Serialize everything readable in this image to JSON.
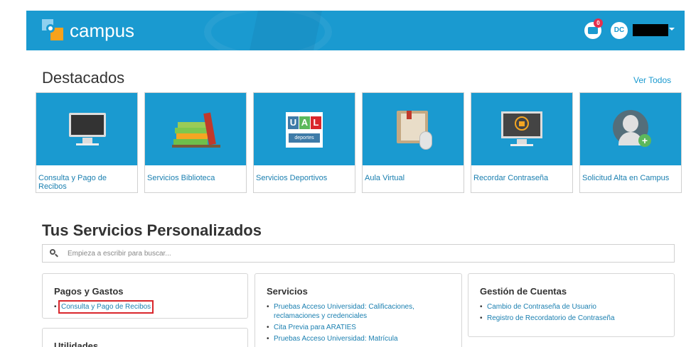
{
  "topbar": {
    "brand": "campus",
    "mail_badge": "0",
    "avatar_initials": "DC",
    "color": "#1a9ad0"
  },
  "destacados": {
    "title": "Destacados",
    "ver_todos": "Ver Todos",
    "cards": [
      {
        "label": "Consulta y Pago de Recibos",
        "icon": "monitor-icon"
      },
      {
        "label": "Servicios Biblioteca",
        "icon": "books-icon"
      },
      {
        "label": "Servicios Deportivos",
        "icon": "ual-deportes-icon",
        "logo_letters": [
          "U",
          "A",
          "L"
        ],
        "logo_sub": "deportes"
      },
      {
        "label": "Aula Virtual",
        "icon": "book-mouse-icon"
      },
      {
        "label": "Recordar Contraseña",
        "icon": "locked-monitor-icon"
      },
      {
        "label": "Solicitud Alta en Campus",
        "icon": "add-user-icon"
      }
    ]
  },
  "servicios": {
    "title": "Tus Servicios Personalizados",
    "search_placeholder": "Empieza a escribir para buscar...",
    "panels": [
      {
        "title": "Pagos y Gastos",
        "items": [
          "Consulta y Pago de Recibos"
        ]
      },
      {
        "title": "Utilidades",
        "items": []
      },
      {
        "title": "Servicios",
        "items": [
          "Pruebas Acceso Universidad: Calificaciones, reclamaciones y credenciales",
          "Cita Previa para ARATIES",
          "Pruebas Acceso Universidad: Matrícula"
        ]
      },
      {
        "title": "Gestión de Cuentas",
        "items": [
          "Cambio de Contraseña de Usuario",
          "Registro de Recordatorio de Contraseña"
        ]
      }
    ]
  }
}
